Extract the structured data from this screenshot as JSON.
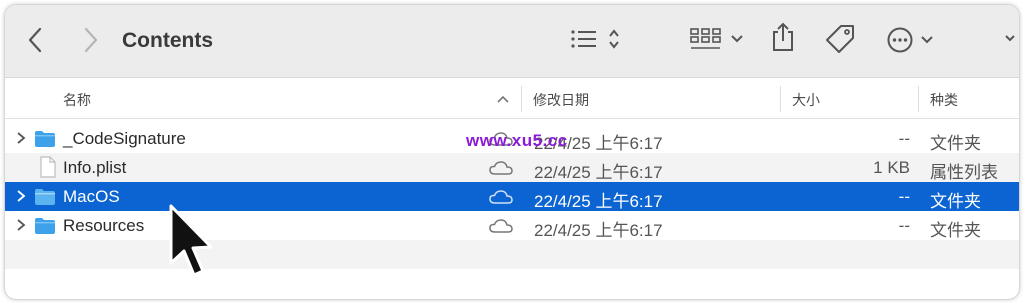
{
  "toolbar": {
    "title": "Contents",
    "icons": [
      "back-chevron-icon",
      "forward-chevron-icon",
      "list-view-icon",
      "sort-updown-icon",
      "grid-view-icon",
      "dropdown-chevron-icon",
      "share-icon",
      "tag-icon",
      "more-ellipsis-icon",
      "dropdown-chevron-icon"
    ]
  },
  "columns": {
    "name": "名称",
    "date": "修改日期",
    "size": "大小",
    "kind": "种类"
  },
  "files": [
    {
      "name": "_CodeSignature",
      "date": "22/4/25 上午6:17",
      "size": "--",
      "kind": "文件夹",
      "type": "folder",
      "icon": "folder-icon",
      "selected": false
    },
    {
      "name": "Info.plist",
      "date": "22/4/25 上午6:17",
      "size": "1 KB",
      "kind": "属性列表",
      "type": "file",
      "icon": "document-icon",
      "selected": false
    },
    {
      "name": "MacOS",
      "date": "22/4/25 上午6:17",
      "size": "--",
      "kind": "文件夹",
      "type": "folder",
      "icon": "folder-icon",
      "selected": true
    },
    {
      "name": "Resources",
      "date": "22/4/25 上午6:17",
      "size": "--",
      "kind": "文件夹",
      "type": "folder",
      "icon": "folder-icon",
      "selected": false
    }
  ],
  "watermark": "www.xu5.cc",
  "colors": {
    "selection": "#0b64d2",
    "folder": "#3da2ea",
    "watermark": "#8a1bd8"
  }
}
